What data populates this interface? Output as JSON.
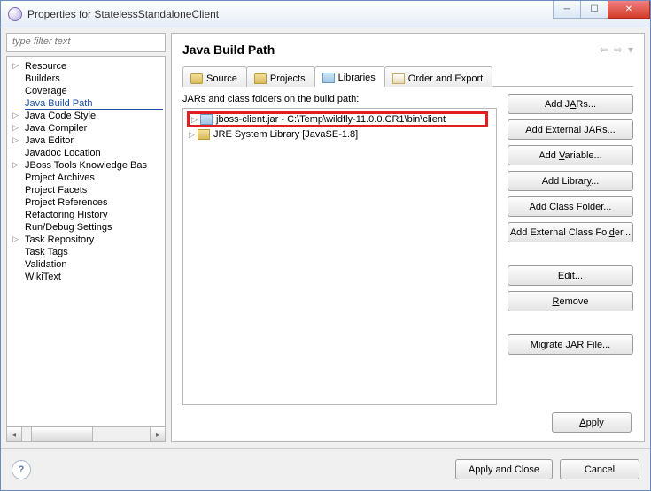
{
  "window": {
    "title": "Properties for StatelessStandaloneClient"
  },
  "filter": {
    "placeholder": "type filter text"
  },
  "tree": [
    {
      "label": "Resource",
      "expandable": true
    },
    {
      "label": "Builders"
    },
    {
      "label": "Coverage"
    },
    {
      "label": "Java Build Path",
      "selected": true
    },
    {
      "label": "Java Code Style",
      "expandable": true
    },
    {
      "label": "Java Compiler",
      "expandable": true
    },
    {
      "label": "Java Editor",
      "expandable": true
    },
    {
      "label": "Javadoc Location"
    },
    {
      "label": "JBoss Tools Knowledge Bas",
      "expandable": true
    },
    {
      "label": "Project Archives"
    },
    {
      "label": "Project Facets"
    },
    {
      "label": "Project References"
    },
    {
      "label": "Refactoring History"
    },
    {
      "label": "Run/Debug Settings"
    },
    {
      "label": "Task Repository",
      "expandable": true
    },
    {
      "label": "Task Tags"
    },
    {
      "label": "Validation"
    },
    {
      "label": "WikiText"
    }
  ],
  "page": {
    "title": "Java Build Path"
  },
  "tabs": [
    {
      "label": "Source",
      "icon": "src"
    },
    {
      "label": "Projects",
      "icon": "prj"
    },
    {
      "label": "Libraries",
      "icon": "lib",
      "active": true
    },
    {
      "label": "Order and Export",
      "icon": "ord"
    }
  ],
  "libraries": {
    "label": "JARs and class folders on the build path:",
    "entries": [
      {
        "label": "jboss-client.jar - C:\\Temp\\wildfly-11.0.0.CR1\\bin\\client",
        "icon": "jar",
        "highlight": true
      },
      {
        "label": "JRE System Library [JavaSE-1.8]",
        "icon": "jre"
      }
    ]
  },
  "buttons": {
    "addJars": "Add JARs...",
    "addExtJars": "Add External JARs...",
    "addVar": "Add Variable...",
    "addLib": "Add Library...",
    "addCF": "Add Class Folder...",
    "addExtCF": "Add External Class Folder...",
    "edit": "Edit...",
    "remove": "Remove",
    "migrate": "Migrate JAR File...",
    "apply": "Apply",
    "applyClose": "Apply and Close",
    "cancel": "Cancel"
  }
}
